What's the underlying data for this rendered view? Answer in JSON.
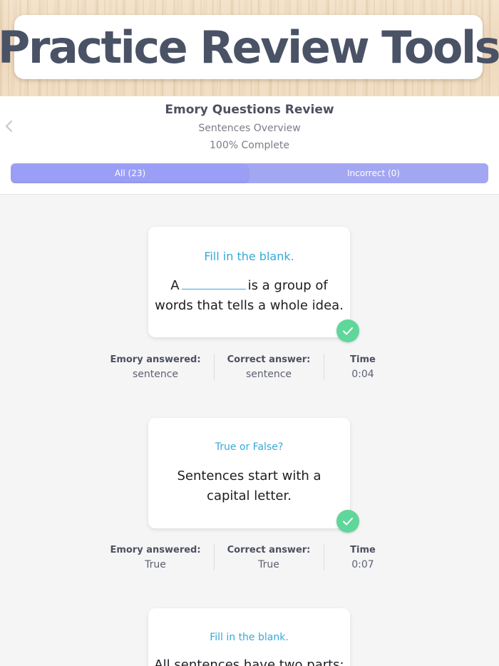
{
  "banner": {
    "title": "Practice Review Tools"
  },
  "header": {
    "title": "Emory Questions Review",
    "subtitle": "Sentences Overview",
    "progress": "100% Complete",
    "back_icon": "chevron-left-icon"
  },
  "segments": {
    "all_label": "All (23)",
    "incorrect_label": "Incorrect (0)",
    "selected": "All (23)"
  },
  "questions": [
    {
      "type": "Fill in the blank.",
      "text_before": "A",
      "text_after": "is a group of words that tells a whole idea.",
      "answered_label": "Emory answered:",
      "answered": "sentence",
      "correct_label": "Correct answer:",
      "correct": "sentence",
      "time_label": "Time",
      "time": "0:04",
      "status_icon": "check-icon"
    },
    {
      "type": "True or False?",
      "text": "Sentences start with a capital letter.",
      "answered_label": "Emory answered:",
      "answered": "True",
      "correct_label": "Correct answer:",
      "correct": "True",
      "time_label": "Time",
      "time": "0:07",
      "status_icon": "check-icon"
    },
    {
      "type": "Fill in the blank.",
      "text": "All sentences have two parts:"
    }
  ],
  "colors": {
    "accent_blue": "#36a9d8",
    "segment_purple": "#a3a6f1",
    "check_green": "#5fd79a",
    "title_slate": "#4a5266"
  }
}
